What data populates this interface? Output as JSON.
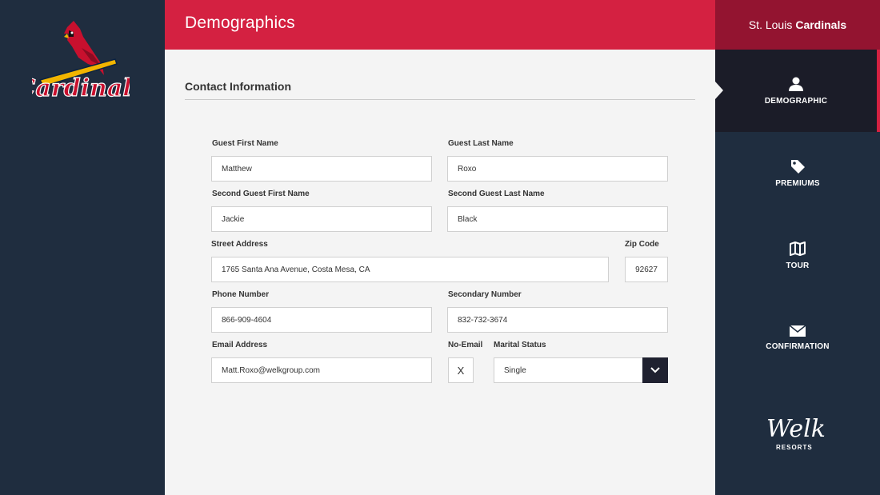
{
  "header": {
    "title": "Demographics"
  },
  "brand": {
    "prefix": "St. Louis",
    "team": "Cardinals"
  },
  "logo": {
    "team_text": "Cardinals"
  },
  "section": {
    "title": "Contact Information"
  },
  "form": {
    "guest_first_name": {
      "label": "Guest First Name",
      "value": "Matthew"
    },
    "guest_last_name": {
      "label": "Guest Last Name",
      "value": "Roxo"
    },
    "second_first_name": {
      "label": "Second Guest First Name",
      "value": "Jackie"
    },
    "second_last_name": {
      "label": "Second Guest Last Name",
      "value": "Black"
    },
    "street_address": {
      "label": "Street Address",
      "value": "1765 Santa Ana Avenue, Costa Mesa, CA"
    },
    "zip_code": {
      "label": "Zip Code",
      "value": "92627"
    },
    "phone": {
      "label": "Phone Number",
      "value": "866-909-4604"
    },
    "secondary_phone": {
      "label": "Secondary Number",
      "value": "832-732-3674"
    },
    "email": {
      "label": "Email Address",
      "value": "Matt.Roxo@welkgroup.com"
    },
    "no_email": {
      "label": "No-Email",
      "value": "X"
    },
    "marital_status": {
      "label": "Marital Status",
      "value": "Single"
    }
  },
  "nav": {
    "items": [
      {
        "label": "DEMOGRAPHIC",
        "icon": "user-icon",
        "active": true
      },
      {
        "label": "PREMIUMS",
        "icon": "tag-icon",
        "active": false
      },
      {
        "label": "TOUR",
        "icon": "map-icon",
        "active": false
      },
      {
        "label": "CONFIRMATION",
        "icon": "envelope-icon",
        "active": false
      }
    ]
  },
  "welk": {
    "script": "Welk",
    "sub": "RESORTS"
  },
  "colors": {
    "primary_red": "#d42141",
    "dark_red": "#931430",
    "navy": "#1f2d3f",
    "active_nav": "#1b1c28"
  }
}
